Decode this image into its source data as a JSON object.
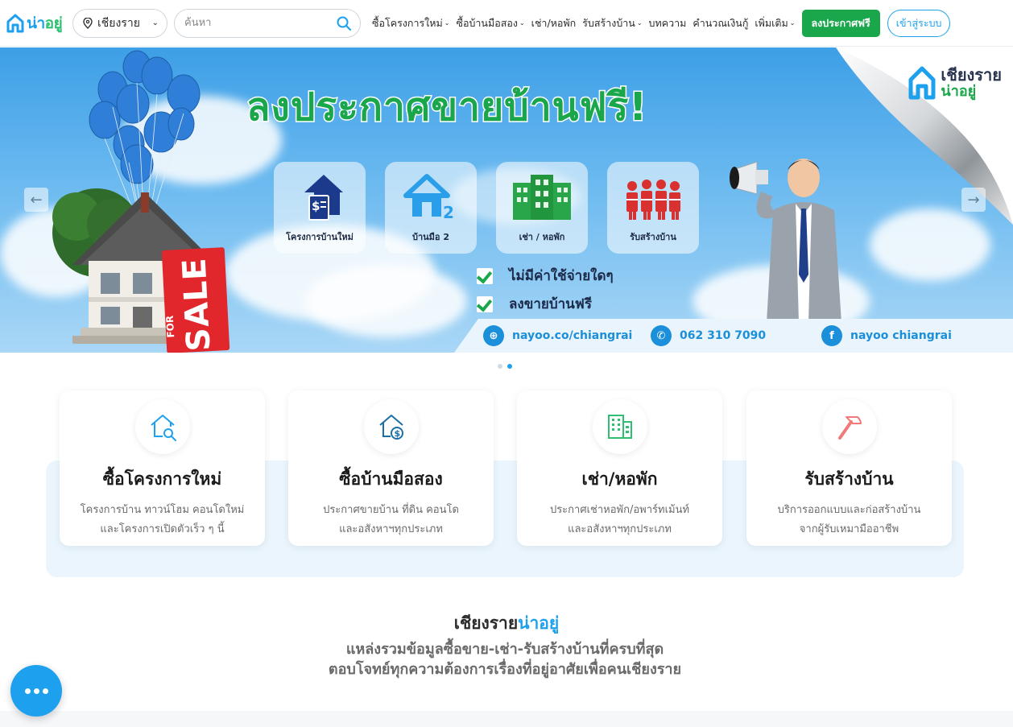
{
  "header": {
    "logo_text_a": "น่า",
    "logo_text_b": "อยู่",
    "location": "เชียงราย",
    "search_placeholder": "ค้นหา",
    "nav": [
      {
        "label": "ซื้อโครงการใหม่",
        "dropdown": true
      },
      {
        "label": "ซื้อบ้านมือสอง",
        "dropdown": true
      },
      {
        "label": "เช่า/หอพัก",
        "dropdown": false
      },
      {
        "label": "รับสร้างบ้าน",
        "dropdown": true
      },
      {
        "label": "บทความ",
        "dropdown": false
      },
      {
        "label": "คำนวณเงินกู้",
        "dropdown": false
      },
      {
        "label": "เพิ่มเติม",
        "dropdown": true
      }
    ],
    "post_button": "ลงประกาศฟรี",
    "login_button": "เข้าสู่ระบบ",
    "accent_color": "#1da1ef",
    "green_color": "#1aa74b"
  },
  "banner": {
    "title": "ลงประกาศขายบ้านฟรี!",
    "brand_top": "เชียงราย",
    "brand_bottom": "น่าอยู่",
    "tiles": [
      "โครงการบ้านใหม่",
      "บ้านมือ 2",
      "เช่า / หอพัก",
      "รับสร้างบ้าน"
    ],
    "checks": [
      "ไม่มีค่าใช้จ่ายใดๆ",
      "ลงขายบ้านฟรี"
    ],
    "sale_sign_top": "FOR",
    "sale_sign": "SALE",
    "contact_web": "nayoo.co/chiangrai",
    "contact_phone": "062 310 7090",
    "contact_fb": "nayoo chiangrai",
    "slide_count": 2,
    "active_slide": 2
  },
  "categories": [
    {
      "title": "ซื้อโครงการใหม่",
      "desc1": "โครงการบ้าน ทาวน์โฮม คอนโดใหม่",
      "desc2": "และโครงการเปิดตัวเร็ว ๆ นี้",
      "icon": "house-search-icon"
    },
    {
      "title": "ซื้อบ้านมือสอง",
      "desc1": "ประกาศขายบ้าน ที่ดิน คอนโด",
      "desc2": "และอสังหาฯทุกประเภท",
      "icon": "house-dollar-icon"
    },
    {
      "title": "เช่า/หอพัก",
      "desc1": "ประกาศเช่าหอพัก/อพาร์ทเม้นท์",
      "desc2": "และอสังหาฯทุกประเภท",
      "icon": "building-icon"
    },
    {
      "title": "รับสร้างบ้าน",
      "desc1": "บริการออกแบบและก่อสร้างบ้าน",
      "desc2": "จากผู้รับเหมามืออาชีพ",
      "icon": "hammer-icon"
    }
  ],
  "about": {
    "title_a": "เชียงราย",
    "title_b": "น่าอยู่",
    "line1": "แหล่งรวมข้อมูลซื้อขาย-เช่า-รับสร้างบ้านที่ครบที่สุด",
    "line2": "ตอบโจทย์ทุกความต้องการเรื่องที่อยู่อาศัยเพื่อคนเชียงราย"
  }
}
